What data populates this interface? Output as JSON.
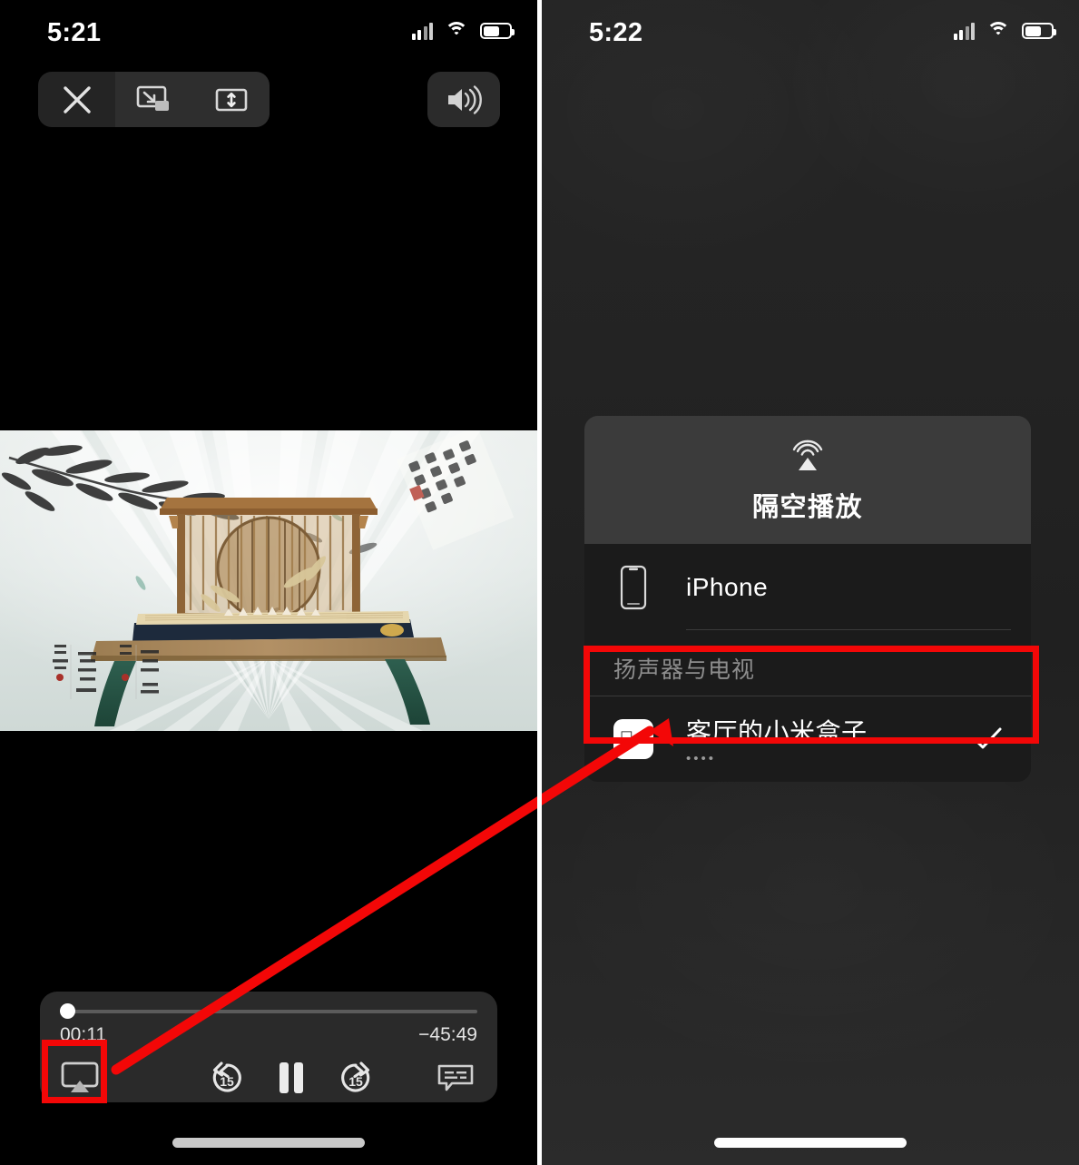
{
  "left_panel": {
    "status_bar": {
      "time": "5:21",
      "icons": [
        "cellular-signal-icon",
        "wifi-icon",
        "battery-icon"
      ]
    },
    "top_controls": {
      "close_label": "close-icon",
      "pip_label": "picture-in-picture-icon",
      "fit_label": "aspect-fit-icon",
      "volume_label": "volume-speaker-icon"
    },
    "video": {
      "description": "guzheng on stand with folding fan backdrop and bamboo ink painting"
    },
    "player": {
      "current_time": "00:11",
      "remaining_time": "−45:49",
      "progress_percent": 0.4,
      "airplay_label": "airplay-icon",
      "rewind_label": "15",
      "playpause_label": "pause-icon",
      "forward_label": "15",
      "captions_label": "closed-captions-icon"
    }
  },
  "right_panel": {
    "status_bar": {
      "time": "5:22",
      "icons": [
        "cellular-signal-icon",
        "wifi-icon",
        "battery-icon"
      ]
    },
    "airplay_dialog": {
      "header_icon": "airplay-icon",
      "title": "隔空播放",
      "devices": [
        {
          "name": "iPhone",
          "icon": "iphone-icon",
          "subtitle": "",
          "selected": false
        }
      ],
      "section_label": "扬声器与电视",
      "speaker_devices": [
        {
          "name": "客厅的小米盒子",
          "icon": "apple-tv-icon",
          "subtitle": "••••",
          "selected": true,
          "check_label": "checkmark-icon"
        }
      ]
    }
  },
  "annotations": {
    "highlight_color": "#f30707",
    "airplay_button_box": "red-highlight-box",
    "device_row_box": "red-highlight-box",
    "arrow": "red-pointer-arrow"
  }
}
